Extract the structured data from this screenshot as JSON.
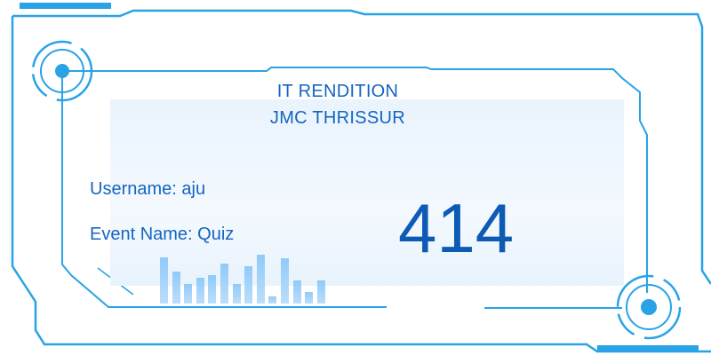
{
  "card": {
    "title_line1": "IT RENDITION",
    "title_line2": "JMC THRISSUR",
    "username_label": "Username:",
    "username_value": "aju",
    "event_label": "Event Name:",
    "event_value": "Quiz",
    "number": "414"
  },
  "equalizer_levels": [
    0.9,
    0.62,
    0.38,
    0.5,
    0.55,
    0.77,
    0.38,
    0.72,
    0.95,
    0.14,
    0.88,
    0.45,
    0.22,
    0.45
  ],
  "colors": {
    "frame": "#29a3e6",
    "text": "#1565c0",
    "number": "#0d5bb5",
    "panel": "#eaf4fd"
  }
}
